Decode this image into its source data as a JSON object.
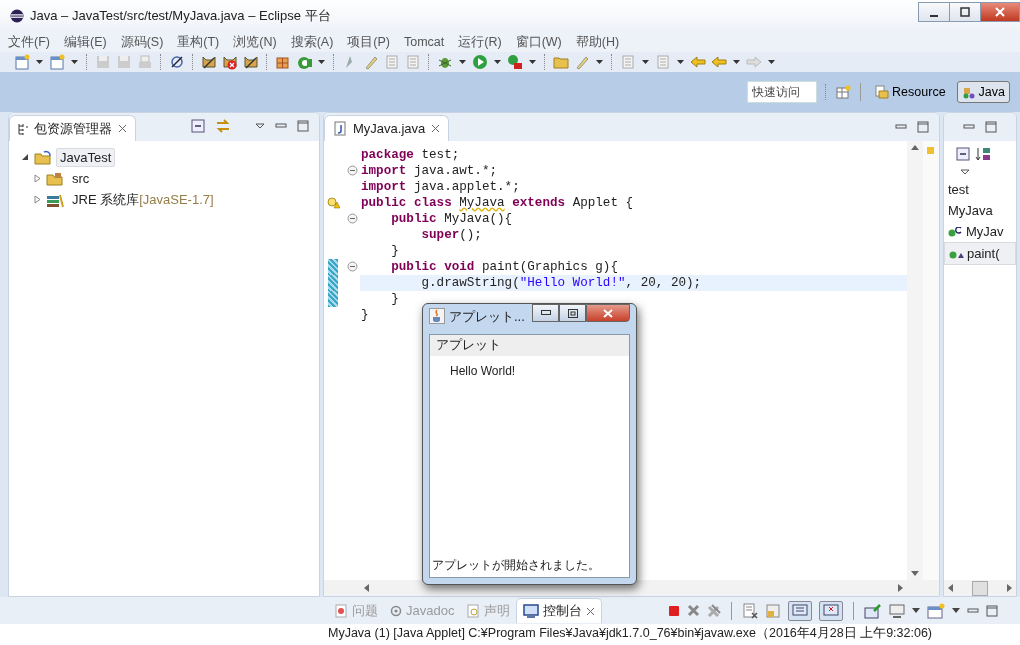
{
  "window": {
    "title": "Java – JavaTest/src/test/MyJava.java – Eclipse 平台"
  },
  "menu": [
    "文件(F)",
    "编辑(E)",
    "源码(S)",
    "重构(T)",
    "浏览(N)",
    "搜索(A)",
    "项目(P)",
    "Tomcat",
    "运行(R)",
    "窗口(W)",
    "帮助(H)"
  ],
  "quick_access": {
    "placeholder": "快速访问"
  },
  "perspectives": [
    {
      "label": "Resource",
      "selected": false
    },
    {
      "label": "Java",
      "selected": true
    }
  ],
  "package_explorer": {
    "title": "包资源管理器",
    "tree": [
      {
        "label": "JavaTest",
        "kind": "project",
        "expanded": true,
        "selected": true,
        "children": [
          {
            "label": "src",
            "kind": "source-folder",
            "expanded": false,
            "selected": false
          },
          {
            "label": "JRE 系统库",
            "decoration": "[JavaSE-1.7]",
            "kind": "library",
            "expanded": false,
            "selected": false
          }
        ]
      }
    ]
  },
  "editor": {
    "tab": "MyJava.java",
    "lines": [
      {
        "fold": false,
        "changed": false,
        "current": false,
        "warning": false,
        "tokens": [
          {
            "kind": "kw",
            "text": "package "
          },
          {
            "kind": "plain",
            "text": "test;"
          }
        ]
      },
      {
        "fold": true,
        "changed": false,
        "current": false,
        "warning": false,
        "tokens": [
          {
            "kind": "kw",
            "text": "import "
          },
          {
            "kind": "plain",
            "text": "java.awt.*;"
          }
        ]
      },
      {
        "fold": false,
        "changed": false,
        "current": false,
        "warning": false,
        "tokens": [
          {
            "kind": "kw",
            "text": "import "
          },
          {
            "kind": "plain",
            "text": "java.applet.*;"
          }
        ]
      },
      {
        "fold": false,
        "changed": false,
        "current": false,
        "warning": true,
        "tokens": [
          {
            "kind": "kw",
            "text": "public class "
          },
          {
            "kind": "warn",
            "text": "MyJava"
          },
          {
            "kind": "kw",
            "text": " extends "
          },
          {
            "kind": "plain",
            "text": "Applet {"
          }
        ]
      },
      {
        "fold": true,
        "changed": false,
        "current": false,
        "warning": false,
        "tokens": [
          {
            "kind": "kw",
            "text": "    public "
          },
          {
            "kind": "plain",
            "text": "MyJava(){"
          }
        ]
      },
      {
        "fold": false,
        "changed": false,
        "current": false,
        "warning": false,
        "tokens": [
          {
            "kind": "kw",
            "text": "        super"
          },
          {
            "kind": "plain",
            "text": "();"
          }
        ]
      },
      {
        "fold": false,
        "changed": false,
        "current": false,
        "warning": false,
        "tokens": [
          {
            "kind": "plain",
            "text": "    }"
          }
        ]
      },
      {
        "fold": true,
        "changed": true,
        "current": false,
        "warning": false,
        "tokens": [
          {
            "kind": "kw",
            "text": "    public void "
          },
          {
            "kind": "plain",
            "text": "paint(Graphics g){"
          }
        ]
      },
      {
        "fold": false,
        "changed": true,
        "current": true,
        "warning": false,
        "tokens": [
          {
            "kind": "plain",
            "text": "        g.drawString("
          },
          {
            "kind": "str",
            "text": "\"Hello World!\""
          },
          {
            "kind": "plain",
            "text": ", 20, 20);"
          }
        ]
      },
      {
        "fold": false,
        "changed": true,
        "current": false,
        "warning": false,
        "tokens": [
          {
            "kind": "plain",
            "text": "    }"
          }
        ]
      },
      {
        "fold": false,
        "changed": false,
        "current": false,
        "warning": false,
        "tokens": [
          {
            "kind": "plain",
            "text": "}"
          }
        ]
      }
    ]
  },
  "outline": {
    "items": [
      {
        "label": "test",
        "kind": "package",
        "selected": false
      },
      {
        "label": "MyJava",
        "kind": "class",
        "selected": false
      },
      {
        "label": "MyJav",
        "kind": "constructor",
        "selected": false
      },
      {
        "label": "paint(",
        "kind": "method",
        "selected": true
      }
    ]
  },
  "applet_window": {
    "title": "アプレット...",
    "menu": "アプレット",
    "content": "Hello World!",
    "status": "アプレットが開始されました。"
  },
  "bottom_tabs": [
    {
      "label": "问题",
      "kind": "problems",
      "selected": false
    },
    {
      "label": "Javadoc",
      "kind": "javadoc",
      "selected": false
    },
    {
      "label": "声明",
      "kind": "declaration",
      "selected": false
    },
    {
      "label": "控制台",
      "kind": "console",
      "selected": true
    }
  ],
  "console": {
    "text": "MyJava (1) [Java Applet] C:¥Program Files¥Java¥jdk1.7.0_76¥bin¥javaw.exe（2016年4月28日 上午9:32:06)"
  }
}
